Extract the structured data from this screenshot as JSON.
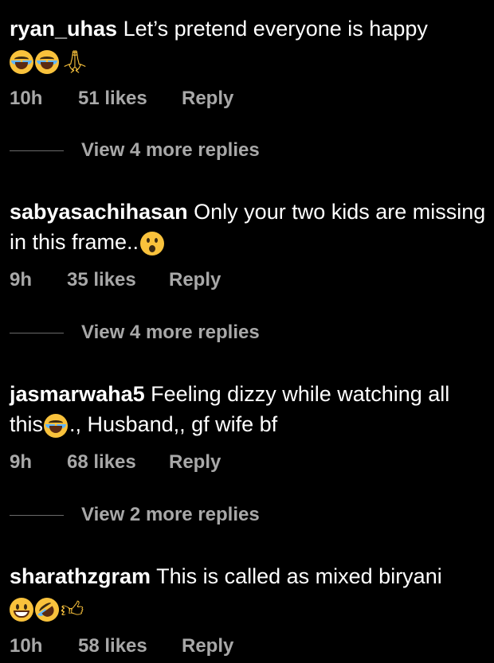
{
  "comments": [
    {
      "username": "ryan_uhas",
      "text": "Let’s pretend everyone is happy",
      "time": "10h",
      "likes": "51 likes",
      "reply": "Reply",
      "emojis": [
        "laughing-emoji",
        "laughing-emoji",
        "folded-hands-emoji"
      ]
    },
    {
      "username": "sabyasachihasan",
      "text": "Only your two kids are missing in this frame..",
      "time": "9h",
      "likes": "35 likes",
      "reply": "Reply",
      "emojis": [
        "surprised-emoji"
      ]
    },
    {
      "username": "jasmarwaha5",
      "text_before": "Feeling dizzy while watching all this",
      "text_after": "., Husband,, gf wife bf",
      "time": "9h",
      "likes": "68 likes",
      "reply": "Reply",
      "emojis": [
        "laughing-emoji"
      ]
    },
    {
      "username": "sharathzgram",
      "text": "This is called as mixed biryani",
      "time": "10h",
      "likes": "58 likes",
      "reply": "Reply",
      "emojis": [
        "grinning-emoji",
        "rolling-laughing-emoji",
        "thumbs-up-emoji"
      ]
    }
  ],
  "view_replies": [
    {
      "label": "View 4 more replies"
    },
    {
      "label": "View 4 more replies"
    },
    {
      "label": "View 2 more replies"
    }
  ],
  "colors": {
    "background": "#000000",
    "text": "#ffffff",
    "secondary_text": "#a8a8a8",
    "emoji_yellow": "#f9c23c"
  }
}
